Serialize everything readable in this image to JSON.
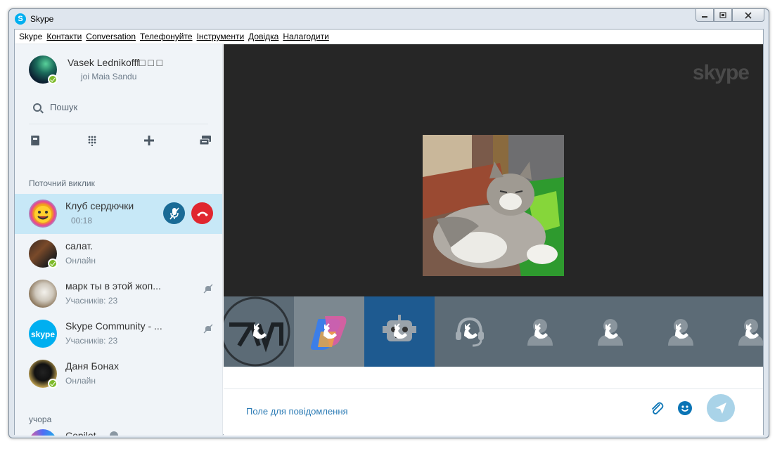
{
  "window": {
    "title": "Skype",
    "app_icon": "skype-logo-icon",
    "controls": [
      "minimize-icon",
      "restore-icon",
      "close-icon"
    ]
  },
  "menu": [
    {
      "label": "Skype"
    },
    {
      "label": "Контакти"
    },
    {
      "label": "Conversation"
    },
    {
      "label": "Телефонуйте"
    },
    {
      "label": "Інструменти"
    },
    {
      "label": "Довідка"
    },
    {
      "label": "Налагодити"
    }
  ],
  "profile": {
    "name": "Vasek Lednikofff□ □ □",
    "mood": "joi Maia Sandu",
    "status": "online"
  },
  "search": {
    "label": "Пошук",
    "icon": "search-icon"
  },
  "toolbar": {
    "icons": [
      "contacts-book-icon",
      "dialpad-icon",
      "add-icon",
      "sms-icon"
    ]
  },
  "sections": {
    "current_call": "Поточний виклик",
    "yesterday": "учора"
  },
  "current_call": {
    "name": "Клуб сердючки",
    "duration": "00:18",
    "mic_icon": "mic-muted-icon",
    "hangup_icon": "hang-up-icon"
  },
  "contacts": [
    {
      "name": "салат.",
      "sub": "Онлайн",
      "status": "online",
      "muted": false
    },
    {
      "name": "марк ты в этой жоп...",
      "sub": "Учасників: 23",
      "muted": true
    },
    {
      "name": "Skype Community - ...",
      "sub": "Учасників: 23",
      "muted": true
    },
    {
      "name": "Даня Бонах",
      "sub": "Онлайн",
      "status": "online",
      "muted": false
    }
  ],
  "yesterday_contacts": [
    {
      "name": "Copilot",
      "badge": "verified-icon"
    }
  ],
  "video": {
    "watermark": "skype"
  },
  "participants": {
    "tiles": [
      "participant-7n",
      "participant-copilot",
      "participant-bot",
      "participant-headset",
      "participant-default",
      "participant-default",
      "participant-default",
      "participant-default"
    ]
  },
  "compose": {
    "placeholder": "Поле для повідомлення",
    "attach_icon": "paperclip-icon",
    "emoji_icon": "smiley-icon",
    "send_icon": "send-icon"
  },
  "colors": {
    "accent": "#00aff0",
    "active_item": "#c7e8f7",
    "hangup": "#e0262f",
    "online": "#7dba2a",
    "link": "#2a7ab4"
  }
}
